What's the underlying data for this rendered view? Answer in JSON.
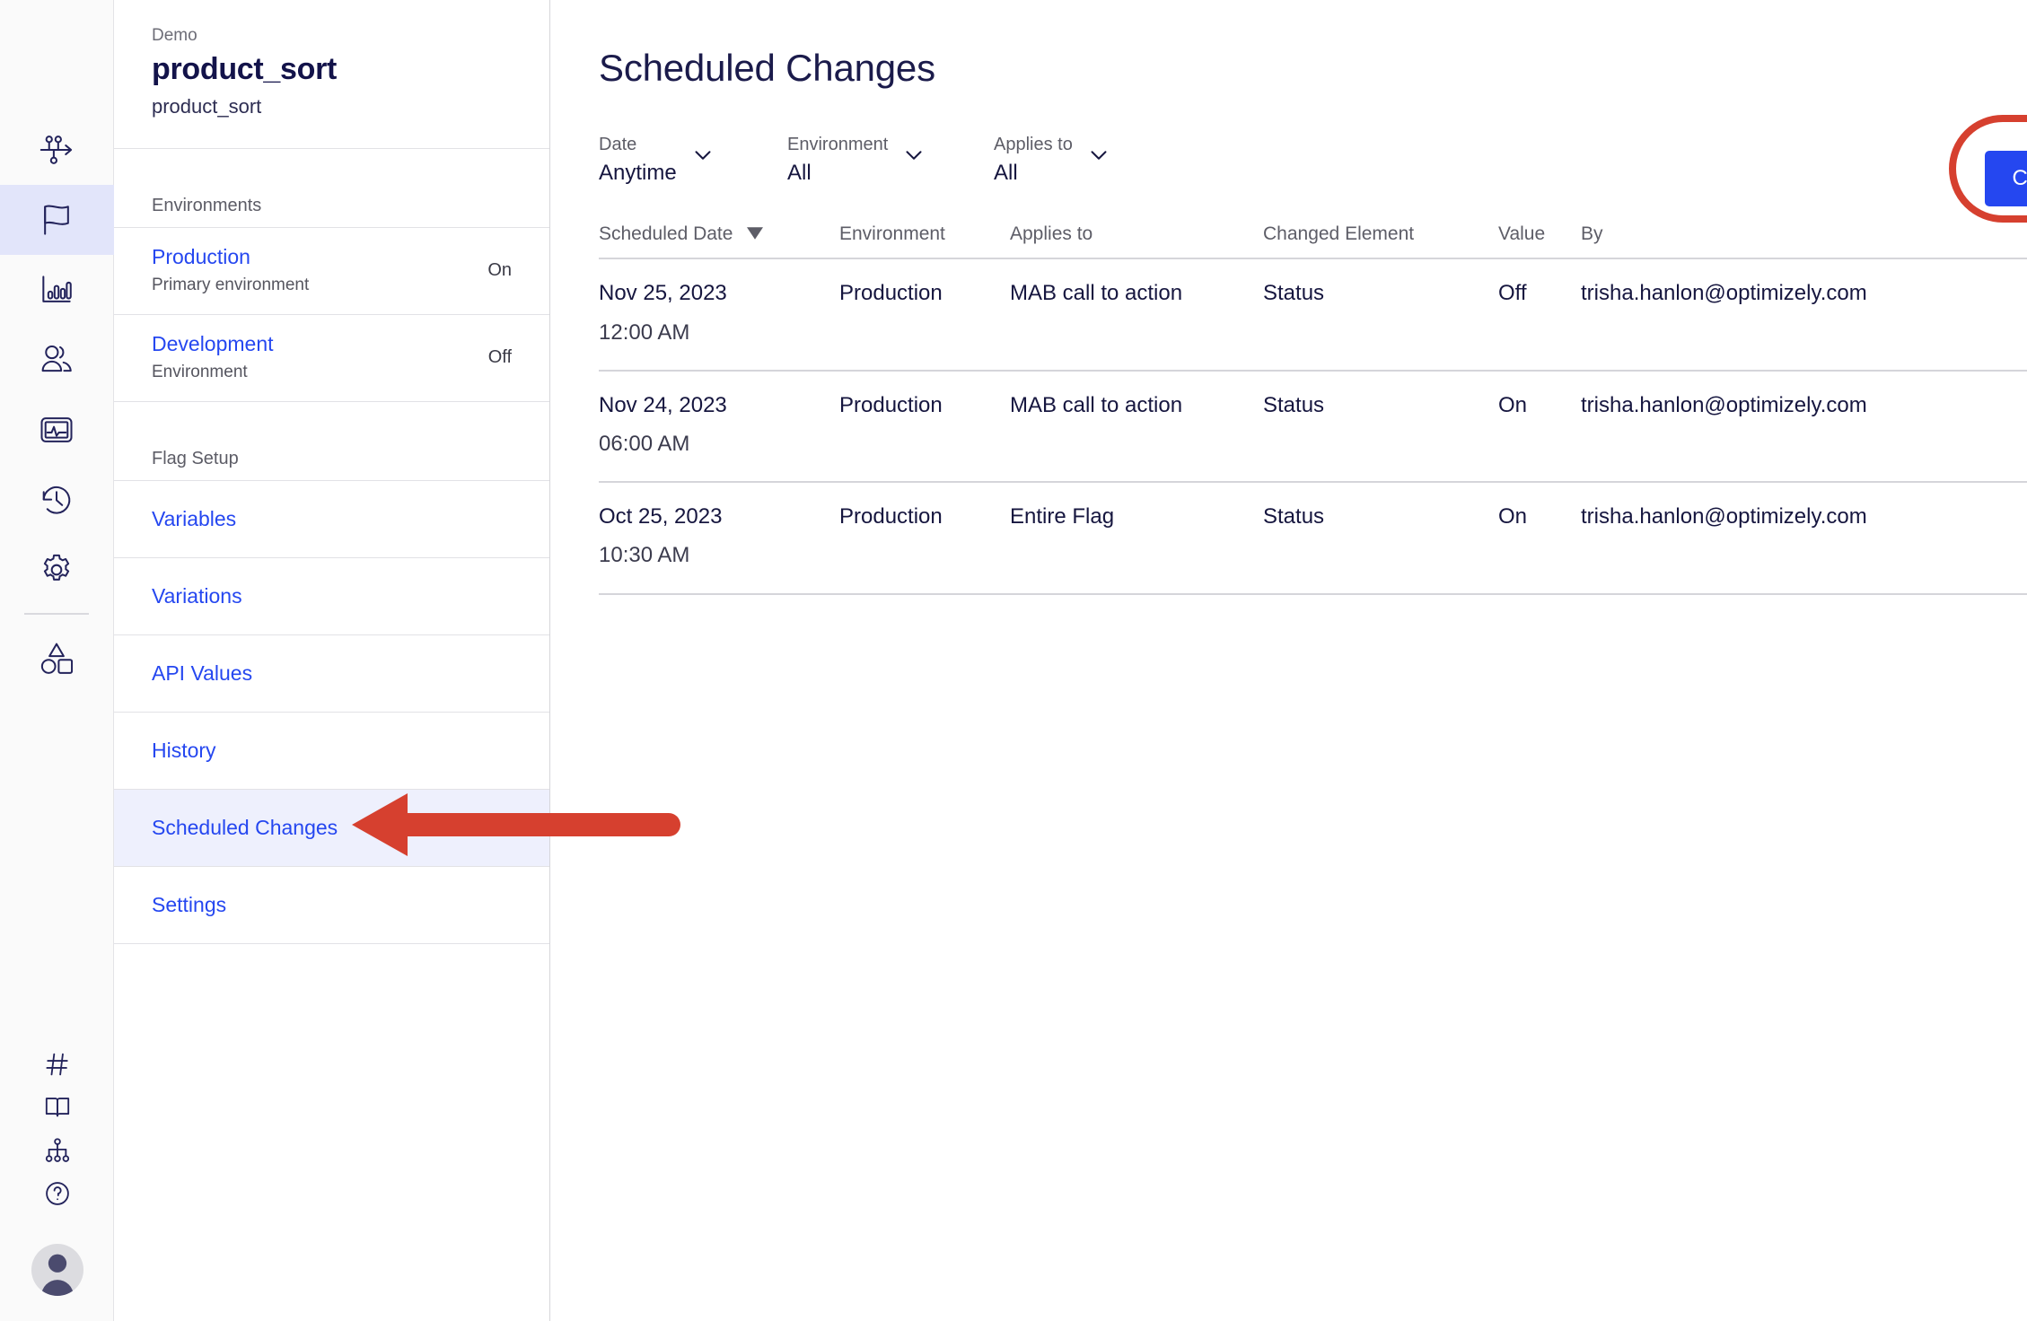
{
  "rail": {
    "items": [
      {
        "name": "experiments-icon",
        "label": "Experiments"
      },
      {
        "name": "flags-icon",
        "label": "Flags"
      },
      {
        "name": "reports-icon",
        "label": "Reports"
      },
      {
        "name": "audiences-icon",
        "label": "Audiences"
      },
      {
        "name": "events-icon",
        "label": "Events"
      },
      {
        "name": "history-icon",
        "label": "History"
      },
      {
        "name": "settings-icon",
        "label": "Settings"
      },
      {
        "name": "shapes-icon",
        "label": "Catalog"
      }
    ],
    "bottom_items": [
      {
        "name": "hash-icon",
        "label": "Hash"
      },
      {
        "name": "book-icon",
        "label": "Docs"
      },
      {
        "name": "sitemap-icon",
        "label": "Sitemap"
      },
      {
        "name": "help-icon",
        "label": "Help"
      }
    ],
    "avatar_label": "Account"
  },
  "sidebar": {
    "eyebrow": "Demo",
    "title": "product_sort",
    "key": "product_sort",
    "environments_label": "Environments",
    "environments": [
      {
        "name": "Production",
        "description": "Primary environment",
        "state": "On"
      },
      {
        "name": "Development",
        "description": "Environment",
        "state": "Off"
      }
    ],
    "flag_setup_label": "Flag Setup",
    "nav": [
      {
        "label": "Variables"
      },
      {
        "label": "Variations"
      },
      {
        "label": "API Values"
      },
      {
        "label": "History"
      },
      {
        "label": "Scheduled Changes"
      },
      {
        "label": "Settings"
      }
    ]
  },
  "main": {
    "page_title": "Scheduled Changes",
    "filters": [
      {
        "label": "Date",
        "value": "Anytime"
      },
      {
        "label": "Environment",
        "value": "All"
      },
      {
        "label": "Applies to",
        "value": "All"
      }
    ],
    "cta_label": "Create New Scheduled Change...",
    "table": {
      "columns": [
        "Scheduled Date",
        "Environment",
        "Applies to",
        "Changed Element",
        "Value",
        "By"
      ],
      "sort_column": "Scheduled Date",
      "sort_direction": "desc",
      "rows": [
        {
          "date": "Nov 25, 2023",
          "time": "12:00 AM",
          "environment": "Production",
          "applies_to": "MAB call to action",
          "changed_element": "Status",
          "value": "Off",
          "by": "trisha.hanlon@optimizely.com",
          "menu": "•••"
        },
        {
          "date": "Nov 24, 2023",
          "time": "06:00 AM",
          "environment": "Production",
          "applies_to": "MAB call to action",
          "changed_element": "Status",
          "value": "On",
          "by": "trisha.hanlon@optimizely.com",
          "menu": "•••"
        },
        {
          "date": "Oct 25, 2023",
          "time": "10:30 AM",
          "environment": "Production",
          "applies_to": "Entire Flag",
          "changed_element": "Status",
          "value": "On",
          "by": "trisha.hanlon@optimizely.com",
          "menu": "•••"
        }
      ]
    }
  },
  "annotations": {
    "arrow_color": "#d6402f",
    "ring_color": "#d6402f",
    "arrow_target": "Scheduled Changes",
    "ring_target": "Create New Scheduled Change..."
  },
  "colors": {
    "link_blue": "#2547f0",
    "brand_navy": "#16163f",
    "active_nav_bg": "#eef0fd",
    "rail_active_bg": "#e2e5fa",
    "annotation_red": "#d6402f"
  }
}
